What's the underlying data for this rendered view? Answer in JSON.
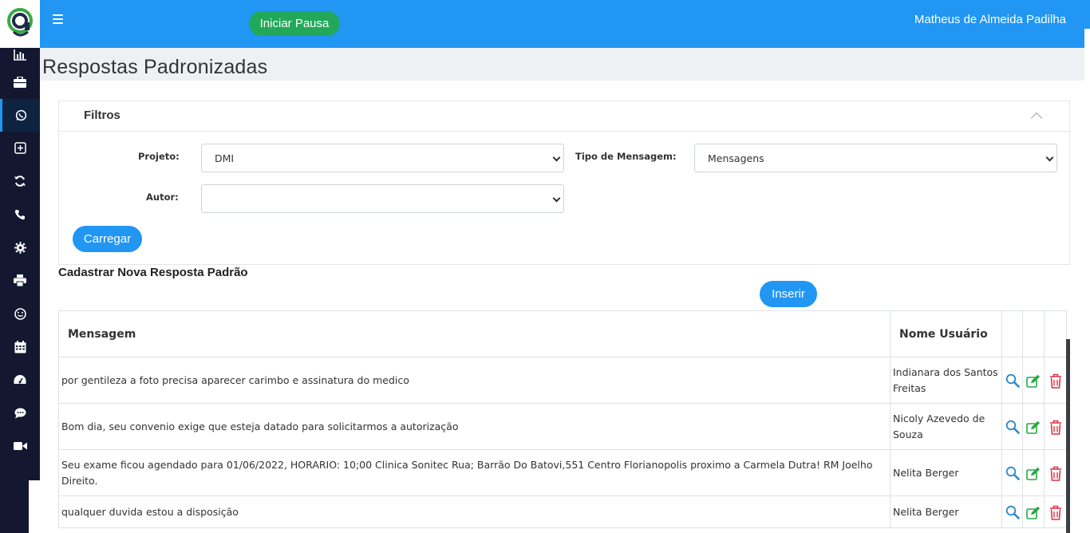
{
  "app": {
    "title": "Respostas Padronizadas",
    "accent_color": "#2196f3",
    "sidebar_color": "#131830"
  },
  "topbar": {
    "menu_icon": "hamburger-icon",
    "pause_label": "Iniciar Pausa",
    "user_name": "Matheus de Almeida Padilha"
  },
  "sidebar": {
    "items": [
      {
        "icon": "bar-chart-icon"
      },
      {
        "icon": "briefcase-icon"
      },
      {
        "icon": "whatsapp-icon",
        "active": true
      },
      {
        "icon": "plus-square-icon"
      },
      {
        "icon": "sync-icon"
      },
      {
        "icon": "phone-icon"
      },
      {
        "icon": "gear-icon"
      },
      {
        "icon": "printer-icon"
      },
      {
        "icon": "smile-icon"
      },
      {
        "icon": "calendar-icon"
      },
      {
        "icon": "dashboard-icon"
      },
      {
        "icon": "chat-icon"
      },
      {
        "icon": "video-icon"
      }
    ]
  },
  "filters": {
    "title": "Filtros",
    "project_label": "Projeto:",
    "project_value": "DMI",
    "type_label": "Tipo de Mensagem:",
    "type_value": "Mensagens",
    "author_label": "Autor:",
    "author_value": "",
    "load_label": "Carregar"
  },
  "register": {
    "title": "Cadastrar Nova Resposta Padrão",
    "insert_label": "Inserir"
  },
  "table": {
    "headers": {
      "message": "Mensagem",
      "user": "Nome Usuário"
    },
    "rows": [
      {
        "message": "por gentileza a foto precisa aparecer carimbo e assinatura do medico",
        "user": "Indianara dos Santos Freitas"
      },
      {
        "message": "Bom dia, seu convenio exige que esteja datado para solicitarmos a autorização",
        "user": "Nicoly Azevedo de Souza"
      },
      {
        "message": "Seu exame ficou agendado para 01/06/2022, HORARIO: 10;00 Clinica Sonitec Rua; Barrão Do Batovi,551 Centro Florianopolis proximo a Carmela Dutra! RM Joelho Direito.",
        "user": "Nelita Berger"
      },
      {
        "message": "qualquer duvida estou a disposição",
        "user": "Nelita Berger"
      }
    ],
    "action_icons": [
      "search-icon",
      "edit-icon",
      "trash-icon"
    ],
    "colors": {
      "view": "#2b87c8",
      "edit": "#28a745",
      "delete": "#dc3545"
    }
  }
}
